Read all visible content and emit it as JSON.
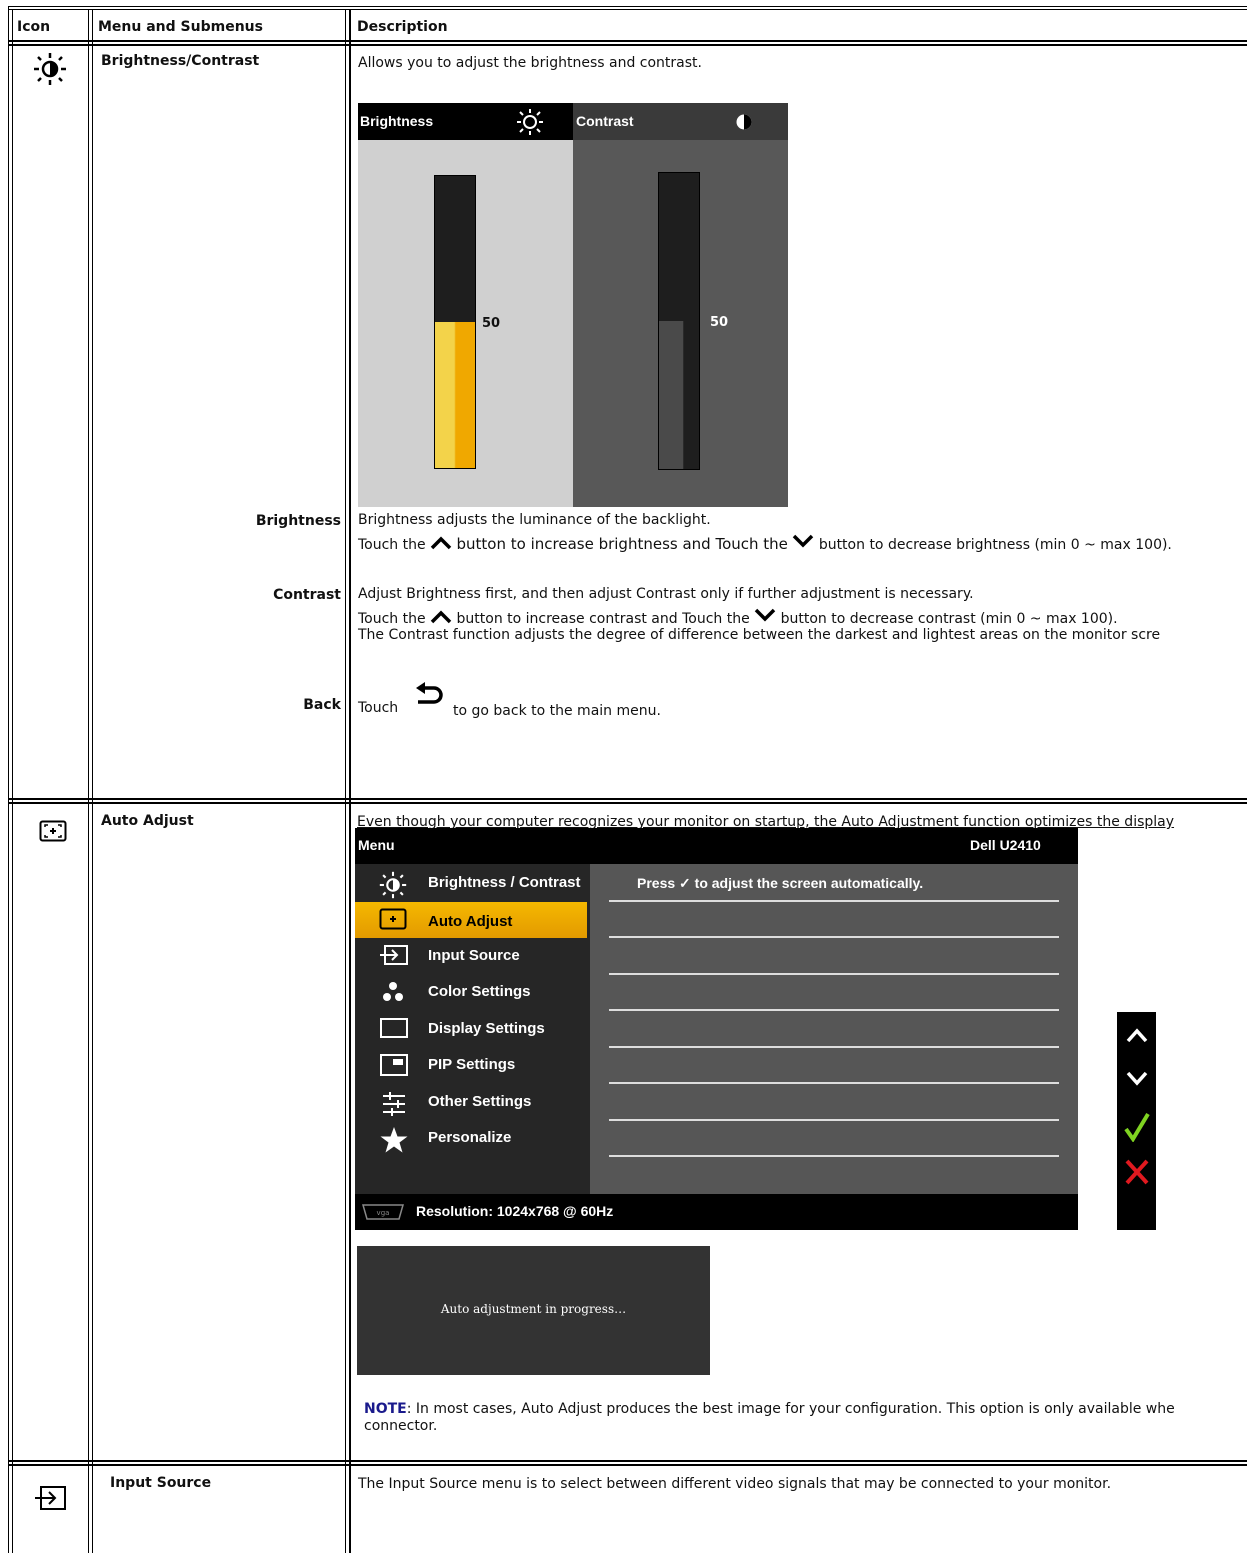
{
  "table": {
    "headers": {
      "icon": "Icon",
      "menu": "Menu and Submenus",
      "desc": "Description"
    }
  },
  "brightness_contrast": {
    "title": "Brightness/Contrast",
    "intro": "Allows you to adjust the brightness and contrast.",
    "osd": {
      "brightness_label": "Brightness",
      "contrast_label": "Contrast",
      "brightness_value": "50",
      "contrast_value": "50",
      "brightness_level": 0.5,
      "contrast_level": 0.5
    },
    "sub": [
      {
        "label": "Brightness",
        "line1": "Brightness adjusts the luminance of the backlight.",
        "line2a": "Touch the",
        "line2b": "button to increase brightness and Touch the",
        "line2c": "button to decrease brightness (min 0 ~ max 100)."
      },
      {
        "label": "Contrast",
        "line1": "Adjust Brightness first, and then adjust Contrast only if further adjustment is necessary.",
        "line2a": "Touch the",
        "line2b": "button to increase contrast and Touch the",
        "line2c": "button to decrease contrast (min 0 ~ max 100).",
        "line3": "The Contrast function adjusts the degree of difference between the darkest and lightest areas on the monitor scre"
      },
      {
        "label": "Back",
        "line1a": "Touch",
        "line1b": "to go back to the main menu."
      }
    ]
  },
  "auto_adjust": {
    "title": "Auto Adjust",
    "intro": "Even though your computer recognizes your monitor on startup, the Auto Adjustment function optimizes the display",
    "osd": {
      "menu_title": "Menu",
      "model": "Dell U2410",
      "items": [
        {
          "label": "Brightness / Contrast",
          "icon": "brightness-icon"
        },
        {
          "label": "Auto Adjust",
          "icon": "auto-adjust-icon"
        },
        {
          "label": "Input Source",
          "icon": "input-source-icon"
        },
        {
          "label": "Color Settings",
          "icon": "color-settings-icon"
        },
        {
          "label": "Display Settings",
          "icon": "display-settings-icon"
        },
        {
          "label": "PIP Settings",
          "icon": "pip-settings-icon"
        },
        {
          "label": "Other Settings",
          "icon": "other-settings-icon"
        },
        {
          "label": "Personalize",
          "icon": "star-icon"
        }
      ],
      "selected_index": 1,
      "panel_text_a": "Press",
      "panel_text_b": "to adjust the screen automatically.",
      "resolution": "Resolution: 1024x768 @ 60Hz",
      "accent_color": "#f0a800"
    },
    "progress_text": "Auto adjustment in progress…",
    "note_label": "NOTE",
    "note_text": ": In most cases, Auto Adjust produces the best image for your configuration. This option is only available whe",
    "note_text2": "connector."
  },
  "input_source": {
    "title": "Input Source",
    "intro": "The Input Source menu is to select between different video signals that may be connected to your monitor."
  }
}
